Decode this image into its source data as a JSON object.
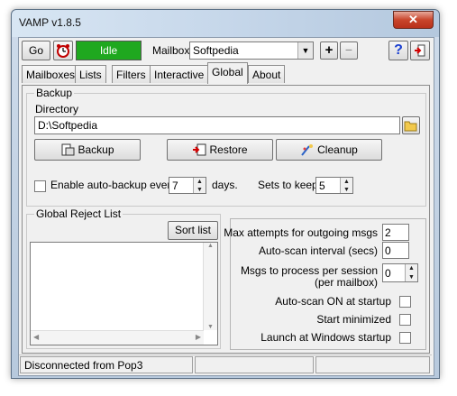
{
  "window": {
    "title": "VAMP v1.8.5",
    "close_glyph": "✕"
  },
  "toolbar": {
    "go_label": "Go",
    "status_label": "Idle",
    "status_color": "#1fa81f",
    "mailbox_label": "Mailbox",
    "mailbox_value": "Softpedia",
    "help_glyph": "?",
    "add_glyph": "+",
    "remove_glyph": "−"
  },
  "tabs": [
    {
      "label": "Mailboxes"
    },
    {
      "label": "Lists"
    },
    {
      "label": "Filters"
    },
    {
      "label": "Interactive"
    },
    {
      "label": "Global"
    },
    {
      "label": "About"
    }
  ],
  "backup": {
    "group_title": "Backup",
    "directory_label": "Directory",
    "directory_value": "D:\\Softpedia",
    "backup_button": "Backup",
    "restore_button": "Restore",
    "cleanup_button": "Cleanup",
    "auto_backup_label": "Enable auto-backup every",
    "auto_backup_checked": false,
    "auto_backup_days": "7",
    "days_label": "days.",
    "sets_label": "Sets to keep",
    "sets_value": "5"
  },
  "reject": {
    "group_title": "Global Reject List",
    "sort_button": "Sort list"
  },
  "settings": {
    "max_attempts_label": "Max attempts for outgoing msgs",
    "max_attempts_value": "2",
    "autoscan_interval_label": "Auto-scan interval (secs)",
    "autoscan_interval_value": "0",
    "msgs_process_label_1": "Msgs to process per session",
    "msgs_process_label_2": "(per mailbox)",
    "msgs_process_value": "0",
    "autoscan_startup_label": "Auto-scan ON at startup",
    "start_minimized_label": "Start minimized",
    "launch_startup_label": "Launch at Windows startup"
  },
  "statusbar": {
    "text": "Disconnected from Pop3"
  }
}
